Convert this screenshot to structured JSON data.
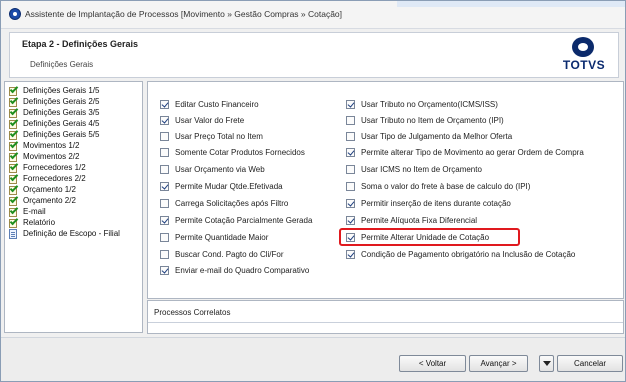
{
  "window": {
    "title": "Assistente de Implantação de Processos [Movimento » Gestão Compras » Cotação]"
  },
  "header": {
    "step_title": "Etapa 2 - Definições Gerais",
    "step_subtitle": "Definições Gerais",
    "logo_text": "TOTVS"
  },
  "sidebar": {
    "items": [
      {
        "label": "Definições Gerais 1/5",
        "icon": "checked-doc-icon"
      },
      {
        "label": "Definições Gerais 2/5",
        "icon": "checked-doc-icon"
      },
      {
        "label": "Definições Gerais 3/5",
        "icon": "checked-doc-icon"
      },
      {
        "label": "Definições Gerais 4/5",
        "icon": "checked-doc-icon"
      },
      {
        "label": "Definições Gerais 5/5",
        "icon": "checked-doc-icon"
      },
      {
        "label": "Movimentos 1/2",
        "icon": "checked-doc-icon"
      },
      {
        "label": "Movimentos 2/2",
        "icon": "checked-doc-icon"
      },
      {
        "label": "Fornecedores 1/2",
        "icon": "checked-doc-icon"
      },
      {
        "label": "Fornecedores 2/2",
        "icon": "checked-doc-icon"
      },
      {
        "label": "Orçamento 1/2",
        "icon": "checked-doc-icon"
      },
      {
        "label": "Orçamento 2/2",
        "icon": "checked-doc-icon"
      },
      {
        "label": "E-mail",
        "icon": "checked-doc-icon"
      },
      {
        "label": "Relatório",
        "icon": "checked-doc-icon"
      },
      {
        "label": "Definição de Escopo - Filial",
        "icon": "doc-icon"
      }
    ]
  },
  "options": {
    "left": [
      {
        "label": "Editar Custo Financeiro",
        "checked": true
      },
      {
        "label": "Usar Valor do Frete",
        "checked": true
      },
      {
        "label": "Usar  Preço Total no Item",
        "checked": false
      },
      {
        "label": "Somente Cotar Produtos Fornecidos",
        "checked": false
      },
      {
        "label": "Usar Orçamento via Web",
        "checked": false
      },
      {
        "label": "Permite Mudar Qtde.Efetivada",
        "checked": true
      },
      {
        "label": "Carrega Solicitações após Filtro",
        "checked": false
      },
      {
        "label": "Permite Cotação Parcialmente Gerada",
        "checked": true
      },
      {
        "label": "Permite Quantidade Maior",
        "checked": false
      },
      {
        "label": "Buscar Cond. Pagto do Cli/For",
        "checked": false
      },
      {
        "label": "Enviar e-mail do Quadro Comparativo",
        "checked": true
      }
    ],
    "right": [
      {
        "label": "Usar Tributo no Orçamento(ICMS/ISS)",
        "checked": true
      },
      {
        "label": "Usar Tributo no Item de Orçamento (IPI)",
        "checked": false
      },
      {
        "label": "Usar Tipo de Julgamento da Melhor Oferta",
        "checked": false
      },
      {
        "label": "Permite alterar Tipo de Movimento ao gerar Ordem de Compra",
        "checked": true
      },
      {
        "label": "Usar ICMS no Item de Orçamento",
        "checked": false
      },
      {
        "label": "Soma o valor do frete à base de calculo do (IPI)",
        "checked": false
      },
      {
        "label": "Permitir inserção de itens durante cotação",
        "checked": true
      },
      {
        "label": "Permite Alíquota Fixa Diferencial",
        "checked": true
      },
      {
        "label": "Permite Alterar Unidade de Cotação",
        "checked": true,
        "highlighted": true
      },
      {
        "label": "Condição de Pagamento obrigatório na Inclusão de Cotação",
        "checked": true
      }
    ]
  },
  "related": {
    "label": "Processos Correlatos"
  },
  "footer": {
    "back_label": "< Voltar",
    "next_label": "Avançar >",
    "cancel_label": "Cancelar"
  },
  "colors": {
    "highlight": "#e0191e",
    "logo": "#0a2a6f",
    "checkmark": "#1f8f1f"
  }
}
